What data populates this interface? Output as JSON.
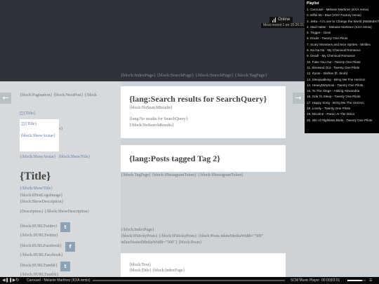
{
  "header": {
    "online_label": "Online",
    "visit_text": "Most recent 1 on 15:26:21"
  },
  "topnav": {
    "text": "{block:IndexPage}  {block:SearchPage}  {/block:SearchPage}  {/block:TagPage}"
  },
  "pagination": {
    "text": "{block:Pagination}  {block:NextPost}  {/block"
  },
  "blog": {
    "title_alt_1": "{Title}",
    "title_alt_2": "{Title}",
    "overlap_label": "{block:ShowTitle}",
    "show_avatar": "{block:ShowAvatar}",
    "show_avatar_end": "{/block:ShowAvatar}",
    "show_title_end": "{block:ShowTitle}",
    "title": "{Title}",
    "show_title_close": "{/block:ShowTitle}",
    "logo_image": "{block:IfNotLogoImage}",
    "show_description": "{block:ShowDescription}",
    "description": "{Description}  {/block:ShowDescription}",
    "twitter_1": "{block:IfURLTwitter}",
    "twitter_2": "{/block:IfURLTwitter}",
    "facebook_1": "{block:IfURLFacebook}",
    "facebook_2": "{/block:IfURLFacebook}",
    "tumblr_1": "{block:IfURLTumblr}",
    "tumblr_2": "{/block:IfURLTumblr}"
  },
  "social": {
    "twitter_glyph": "t",
    "facebook_glyph": "f",
    "tumblr_glyph": "t"
  },
  "search_card": {
    "heading": "{lang:Search results for SearchQuery}",
    "no_results_block": "{block:NoSearchResults}",
    "no_results_text": "{lang:No results for SearchQuery}",
    "no_results_end": "{/block:NoSearchResults}"
  },
  "tag_card": {
    "heading": "{lang:Posts tagged Tag 2}"
  },
  "tag_line": {
    "text": "{/block:TagPage}  {block:IfInstagramToken}  {/block:IfInstagramToken}"
  },
  "index_block": {
    "line1": "{/block:IndexPage}",
    "line2": "{block:IfStickyPosts}  {/block:IfStickyPosts}  {block:Posts inlineMediaWidth=\"500\"",
    "line3": "inlineNestedMediaWidth=\"500\"}  {block:Posts}"
  },
  "post_card": {
    "line1": "{block:Text}",
    "line2": "{block:Title}  {block:IndexPage}"
  },
  "playlist": {
    "heading": "Playlist",
    "items": [
      "1. Carousel - Melanie Martinez (KXA remix)",
      "2. Eiffel 65 - Blue (KNY Factory remix)",
      "3. Jetta - I'd Love to Change the World (Matstubs Remix)",
      "4. Mad Hatter - Melanie Martinez (KXA remix)",
      "5. Trigger - Gioni",
      "6. Doubt - Twenty One Pilots",
      "7. Scary Monsters and Nice Sprites - Skrillex",
      "8. Na Na Na - My Chemical Romance",
      "9. Dead! - My Chemical Romance",
      "10. Fake You Out - Twenty One Pilots",
      "11. Stressed Out - Twenty One Pilots",
      "12. Kyoto - Skrillex (ft. Sirah)",
      "13. Sleepwalking - Bring Me The Horizon",
      "14. HeavyDirtySoul - Twenty One Pilots",
      "15. To The Stage - Asking Alexandria",
      "16. Ode To Sleep - Twenty One Pilots",
      "17. Happy Song - Bring Me The Horizon",
      "18. Lovely - Twenty One Pilots",
      "19. Nicotine - Panic! At The Disco",
      "20. Isle of Flightless Birds - Twenty One Pilots"
    ]
  },
  "player": {
    "now_playing": "Carousel - Melanie Martinez (KXA remix)",
    "brand": "SCM Music Player",
    "time": "00:00|03:01",
    "progress": 0.0,
    "volume": 0.8
  },
  "colors": {
    "header_bg": "#2f3239",
    "page_bg": "#ccd2d5",
    "accent_link": "#6678a8",
    "social_btn": "#8da2b5"
  }
}
